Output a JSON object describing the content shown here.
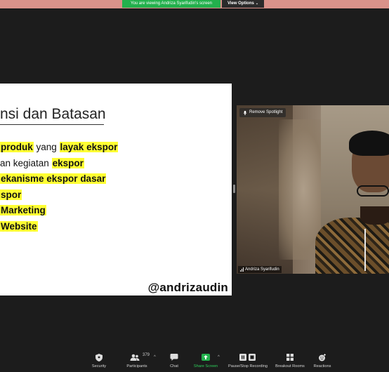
{
  "banner": {
    "viewing_text": "You are viewing Andriza Syarifudin's screen",
    "view_options_label": "View Options",
    "colors": {
      "strip": "#d9928a",
      "pill": "#23b14d"
    }
  },
  "slide": {
    "title": "nsi dan Batasan",
    "bullets": [
      {
        "parts": [
          {
            "text": "produk",
            "hl": true
          },
          {
            "text": " yang ",
            "hl": false
          },
          {
            "text": "layak ekspor",
            "hl": true
          }
        ]
      },
      {
        "parts": [
          {
            "text": "an kegiatan ",
            "hl": false
          },
          {
            "text": "ekspor",
            "hl": true
          }
        ]
      },
      {
        "parts": [
          {
            "text": "ekanisme ekspor dasar",
            "hl": true
          }
        ]
      },
      {
        "parts": [
          {
            "text": "spor",
            "hl": true
          }
        ]
      },
      {
        "parts": [
          {
            "text": "Marketing",
            "hl": true
          }
        ]
      },
      {
        "parts": [
          {
            "text": "Website",
            "hl": true
          }
        ]
      }
    ],
    "watermark": "@andrizaudin"
  },
  "video": {
    "spotlight_label": "Remove Spotlight",
    "participant_name": "Andriza Syarifudin"
  },
  "toolbar": {
    "security": "Security",
    "participants": "Participants",
    "participants_count": "379",
    "chat": "Chat",
    "share_screen": "Share Screen",
    "recording": "Pause/Stop Recording",
    "breakout": "Breakout Rooms",
    "reactions": "Reactions"
  }
}
